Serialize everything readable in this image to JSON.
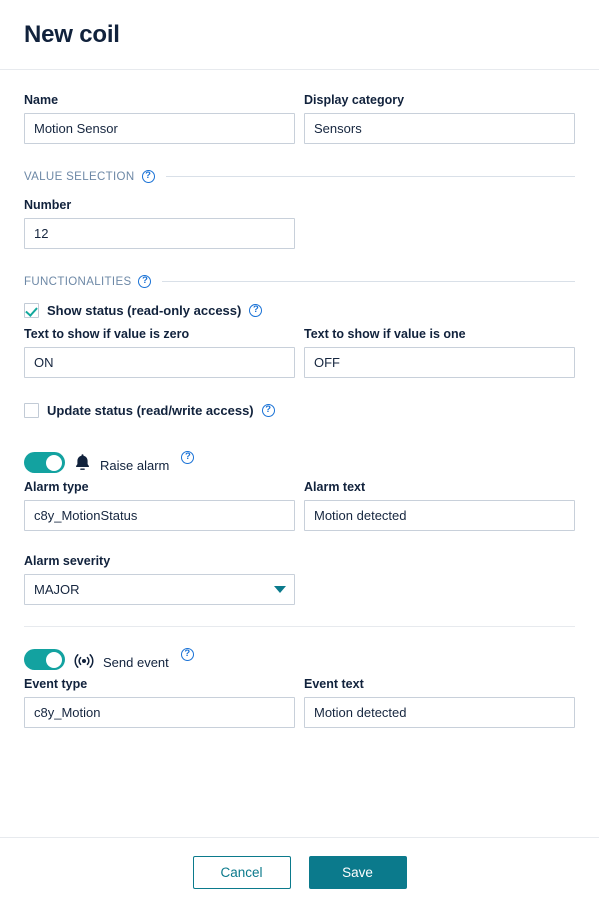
{
  "header": {
    "title": "New coil"
  },
  "form": {
    "name": {
      "label": "Name",
      "value": "Motion Sensor"
    },
    "display_category": {
      "label": "Display category",
      "value": "Sensors"
    },
    "value_selection": {
      "legend": "VALUE SELECTION",
      "help_icon": "help-circle-icon",
      "number": {
        "label": "Number",
        "value": "12"
      }
    },
    "functionalities": {
      "legend": "FUNCTIONALITIES",
      "help_icon": "help-circle-icon",
      "show_status": {
        "label": "Show status (read-only access)",
        "checked": true,
        "text_zero": {
          "label": "Text to show if value is zero",
          "value": "ON"
        },
        "text_one": {
          "label": "Text to show if value is one",
          "value": "OFF"
        }
      },
      "update_status": {
        "label": "Update status (read/write access)",
        "checked": false
      },
      "raise_alarm": {
        "label": "Raise alarm",
        "enabled": true,
        "icon": "bell-icon",
        "alarm_type": {
          "label": "Alarm type",
          "value": "c8y_MotionStatus"
        },
        "alarm_text": {
          "label": "Alarm text",
          "value": "Motion detected"
        },
        "alarm_severity": {
          "label": "Alarm severity",
          "value": "MAJOR"
        }
      },
      "send_event": {
        "label": "Send event",
        "enabled": true,
        "icon": "broadcast-icon",
        "event_type": {
          "label": "Event type",
          "value": "c8y_Motion"
        },
        "event_text": {
          "label": "Event text",
          "value": "Motion detected"
        }
      }
    }
  },
  "footer": {
    "cancel_label": "Cancel",
    "save_label": "Save"
  },
  "colors": {
    "accent_teal": "#0b7a8c",
    "toggle_on": "#13a2a0",
    "help_blue": "#1a72d6",
    "legend_text": "#6d88a6",
    "text_dark": "#11223c"
  }
}
